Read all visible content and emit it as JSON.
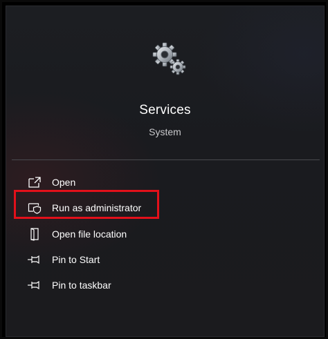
{
  "app": {
    "title": "Services",
    "subtitle": "System",
    "icon": "gears-icon"
  },
  "menu": {
    "items": [
      {
        "label": "Open",
        "icon": "open-icon"
      },
      {
        "label": "Run as administrator",
        "icon": "shield-icon"
      },
      {
        "label": "Open file location",
        "icon": "file-location-icon"
      },
      {
        "label": "Pin to Start",
        "icon": "pin-icon"
      },
      {
        "label": "Pin to taskbar",
        "icon": "pin-icon"
      }
    ]
  },
  "colors": {
    "highlight": "#e3101a",
    "panel": "#1b1c20",
    "text": "#ffffff"
  }
}
